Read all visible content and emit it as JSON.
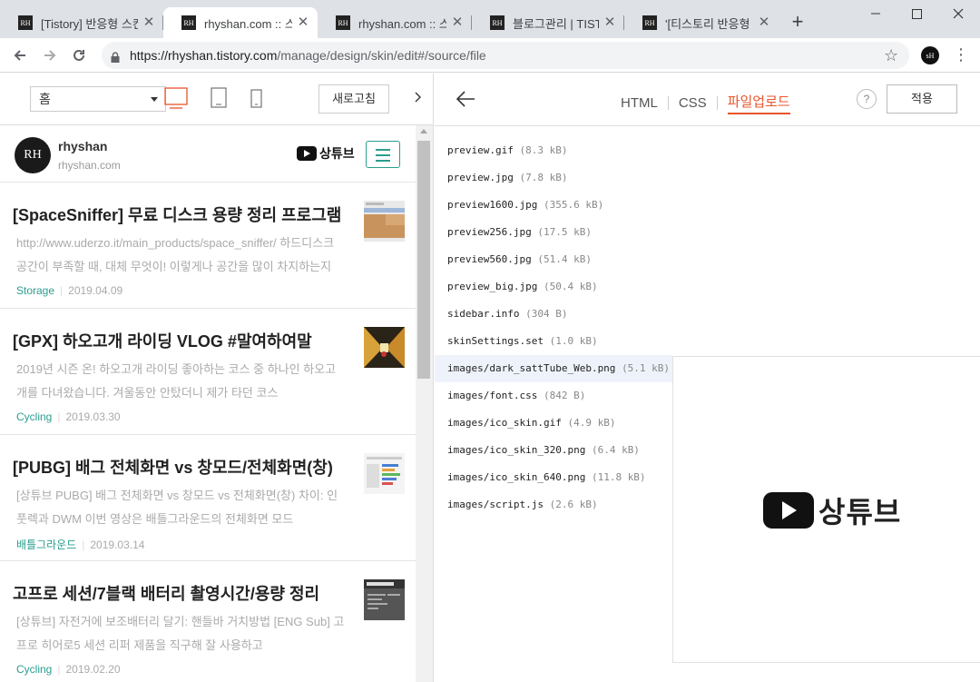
{
  "browser": {
    "tabs": [
      {
        "favicon": "RH",
        "title": "[Tistory] 반응형 스킨"
      },
      {
        "favicon": "RH",
        "title": "rhyshan.com :: 스킨"
      },
      {
        "favicon": "RH",
        "title": "rhyshan.com :: 스킨"
      },
      {
        "favicon": "RH",
        "title": "블로그관리 | TISTORY"
      },
      {
        "favicon": "RH",
        "title": "'[티스토리 반응형 스"
      }
    ],
    "new_tab": "+",
    "url_host": "https://rhyshan.tistory.com",
    "url_path": "/manage/design/skin/edit#/source/file",
    "profile": "sH"
  },
  "preview": {
    "page_select": "홈",
    "refresh_label": "새로고침",
    "blog": {
      "avatar": "RH",
      "name": "rhyshan",
      "domain": "rhyshan.com",
      "brand": "상튜브"
    },
    "posts": [
      {
        "title": "[SpaceSniffer] 무료 디스크 용량 정리 프로그램",
        "excerpt": "http://www.uderzo.it/main_products/space_sniffer/ 하드디스크 공간이 부족할 때, 대체 무엇이! 이렇게나 공간을 많이 차지하는지",
        "category": "Storage",
        "date": "2019.04.09"
      },
      {
        "title": "[GPX] 하오고개 라이딩 VLOG #말여하여말",
        "excerpt": "2019년 시즌 온! 하오고개 라이딩 좋아하는 코스 중 하나인 하오고개를 다녀왔습니다. 겨울동안 안탔더니 제가 타던 코스",
        "category": "Cycling",
        "date": "2019.03.30"
      },
      {
        "title": "[PUBG] 배그 전체화면 vs 창모드/전체화면(창)",
        "excerpt": "[상튜브 PUBG] 배그 전체화면 vs 창모드 vs 전체화면(창) 차이: 인풋렉과 DWM 이번 영상은 배틀그라운드의 전체화면 모드",
        "category": "배틀그라운드",
        "date": "2019.03.14"
      },
      {
        "title": "고프로 세션/7블랙 배터리 촬영시간/용량 정리",
        "excerpt": "[상튜브] 자전거에 보조배터리 달기: 핸들바 거치방법 [ENG Sub] 고프로 히어로5 세션 리퍼 제품을 직구해 잘 사용하고",
        "category": "Cycling",
        "date": "2019.02.20"
      }
    ]
  },
  "editor": {
    "tabs": [
      "HTML",
      "CSS",
      "파일업로드"
    ],
    "active_tab": "파일업로드",
    "help": "?",
    "apply_label": "적용",
    "files": [
      {
        "name": "preview.gif",
        "size": "(8.3 kB)"
      },
      {
        "name": "preview.jpg",
        "size": "(7.8 kB)"
      },
      {
        "name": "preview1600.jpg",
        "size": "(355.6 kB)"
      },
      {
        "name": "preview256.jpg",
        "size": "(17.5 kB)"
      },
      {
        "name": "preview560.jpg",
        "size": "(51.4 kB)"
      },
      {
        "name": "preview_big.jpg",
        "size": "(50.4 kB)"
      },
      {
        "name": "sidebar.info",
        "size": "(304 B)"
      },
      {
        "name": "skinSettings.set",
        "size": "(1.0 kB)"
      },
      {
        "name": "images/dark_sattTube_Web.png",
        "size": "(5.1 kB)"
      },
      {
        "name": "images/font.css",
        "size": "(842 B)"
      },
      {
        "name": "images/ico_skin.gif",
        "size": "(4.9 kB)"
      },
      {
        "name": "images/ico_skin_320.png",
        "size": "(6.4 kB)"
      },
      {
        "name": "images/ico_skin_640.png",
        "size": "(11.8 kB)"
      },
      {
        "name": "images/script.js",
        "size": "(2.6 kB)"
      }
    ],
    "selected_file": "images/dark_sattTube_Web.png",
    "preview_brand": "상튜브"
  },
  "colors": {
    "accent": "#e8552b",
    "teal": "#2a9d8f"
  }
}
